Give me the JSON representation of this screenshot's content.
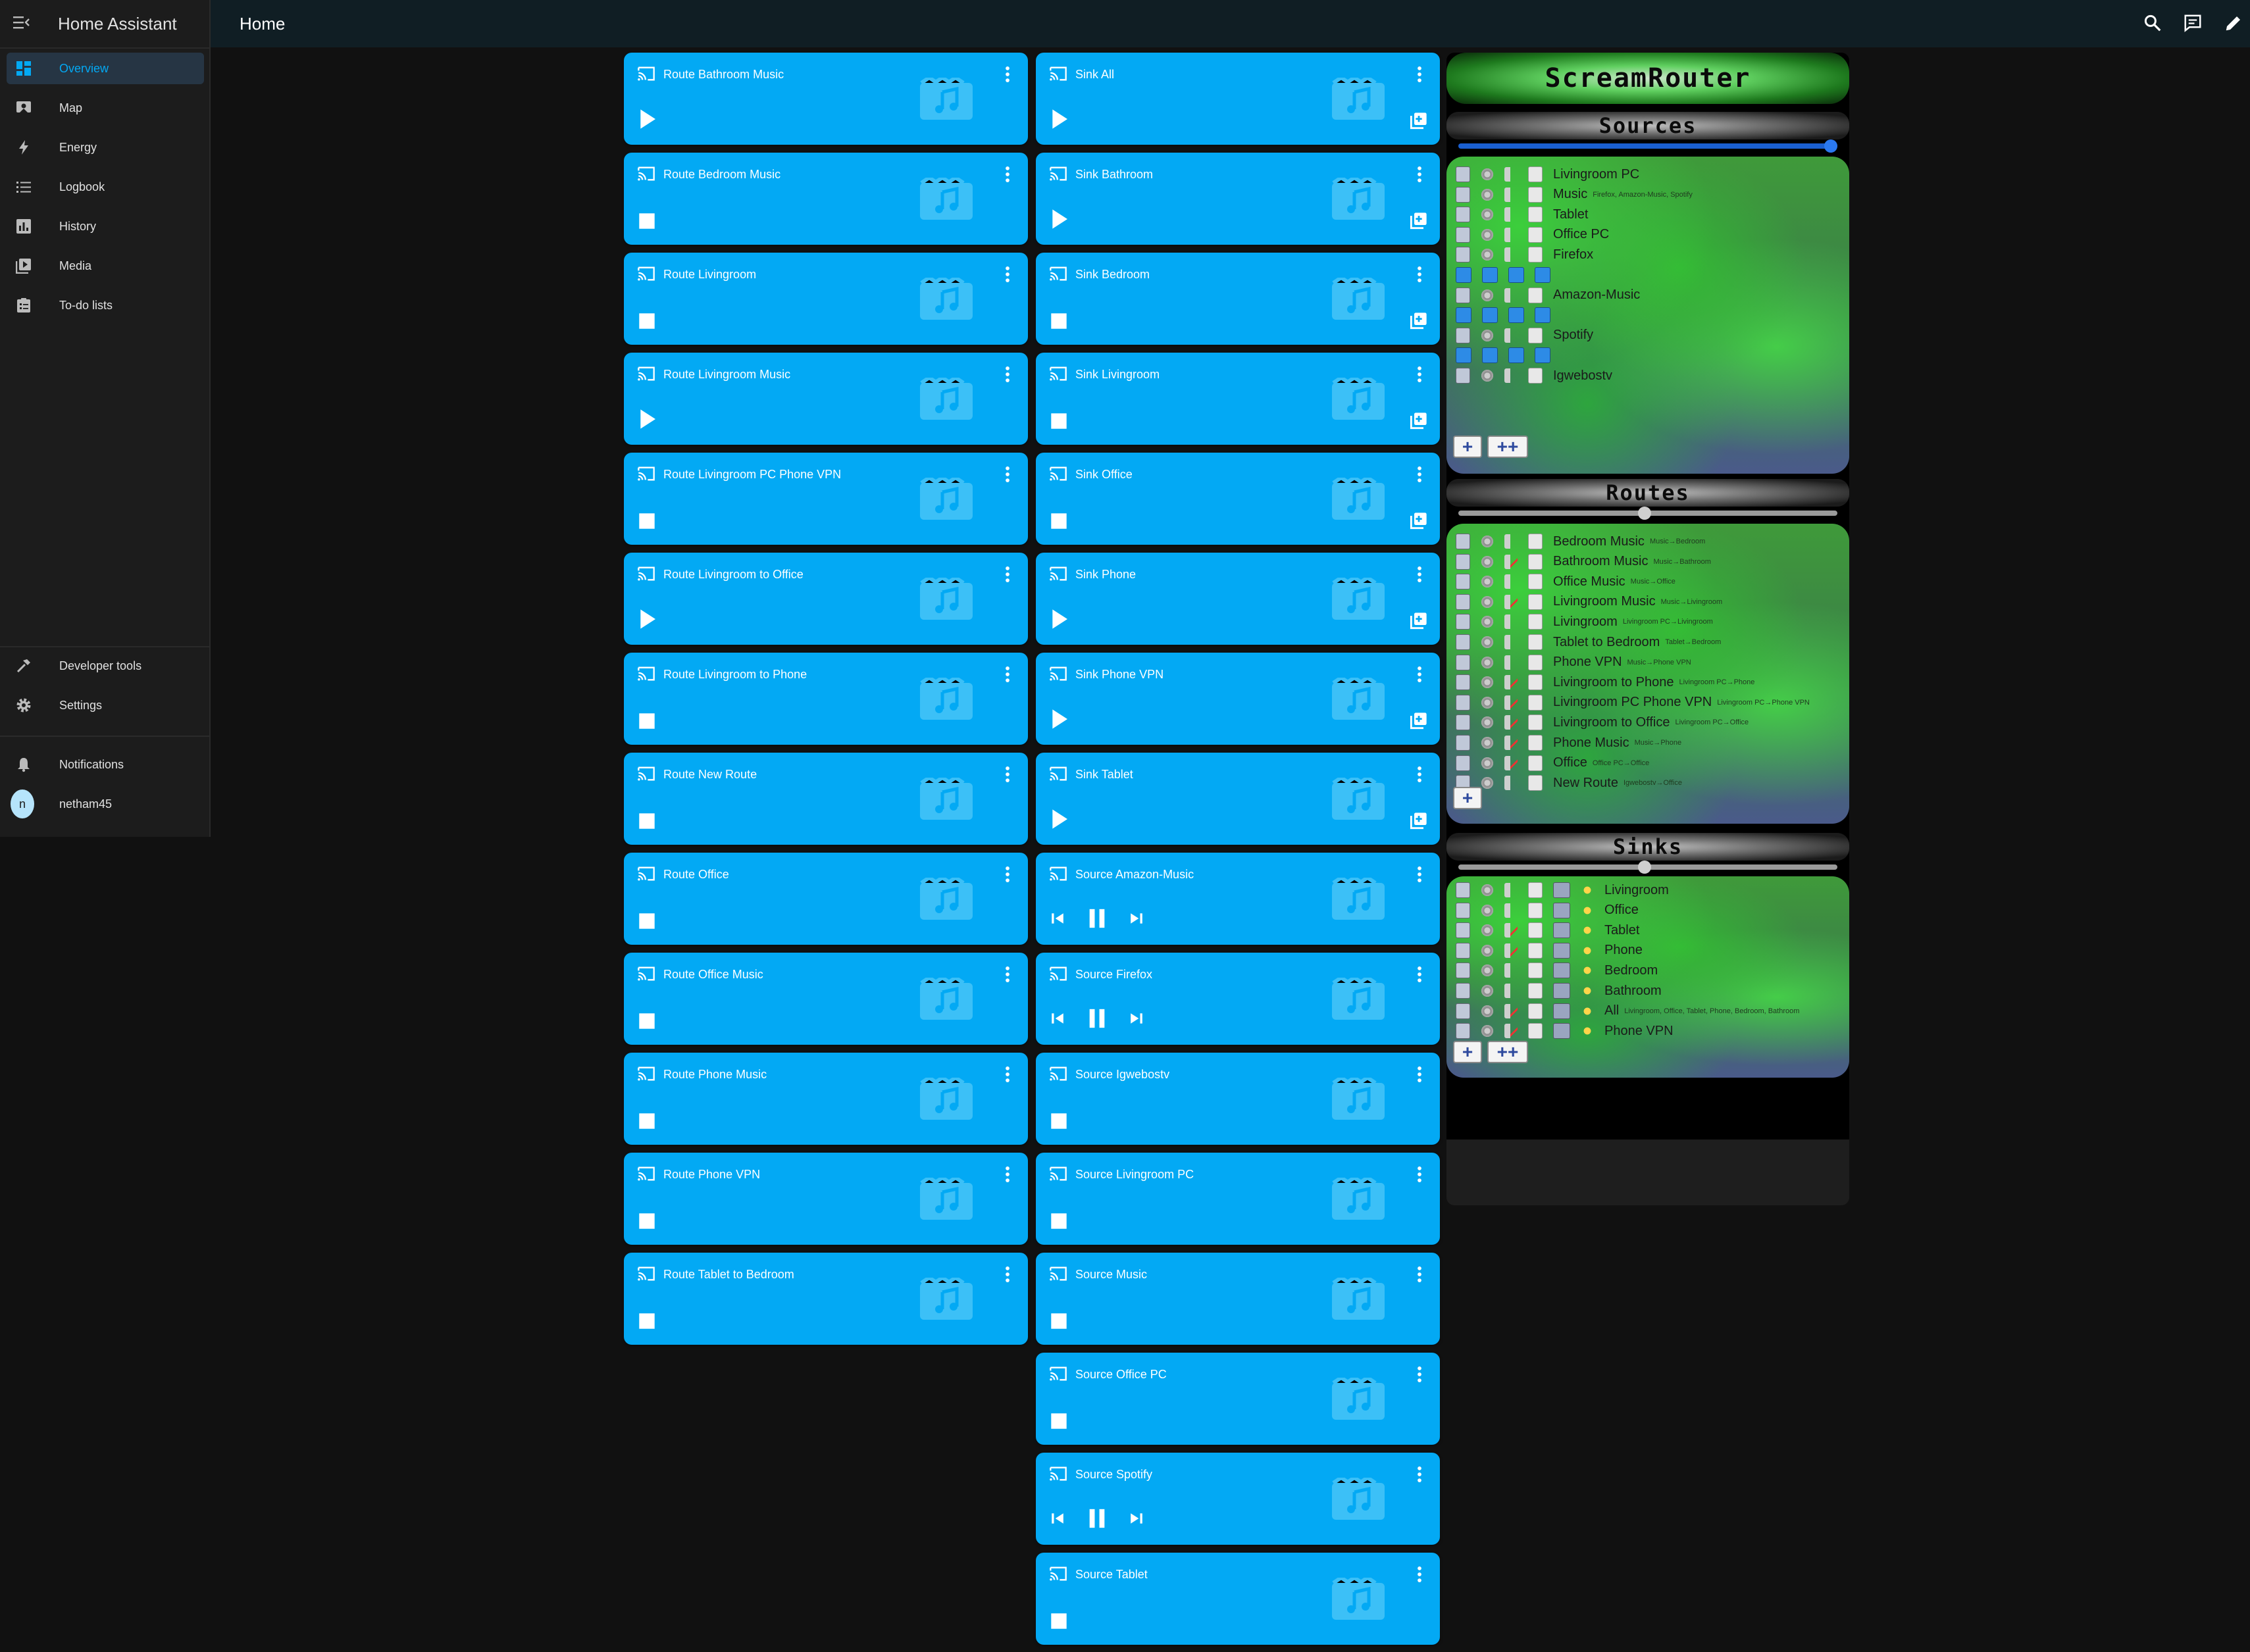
{
  "sidebar": {
    "title": "Home Assistant",
    "items": [
      {
        "label": "Overview",
        "icon": "view-dashboard-icon",
        "selected": true
      },
      {
        "label": "Map",
        "icon": "map-icon"
      },
      {
        "label": "Energy",
        "icon": "lightning-bolt-icon"
      },
      {
        "label": "Logbook",
        "icon": "format-list-bulleted-icon"
      },
      {
        "label": "History",
        "icon": "chart-box-icon"
      },
      {
        "label": "Media",
        "icon": "play-box-multiple-icon"
      },
      {
        "label": "To-do lists",
        "icon": "clipboard-list-icon"
      }
    ],
    "bottom": {
      "developer_tools": "Developer tools",
      "settings": "Settings",
      "notifications": "Notifications",
      "user": "netham45",
      "user_initial": "n"
    }
  },
  "header": {
    "title": "Home"
  },
  "cards_left": [
    {
      "name": "Route Bathroom Music",
      "control": "play"
    },
    {
      "name": "Route Bedroom Music",
      "control": "stop"
    },
    {
      "name": "Route Livingroom",
      "control": "stop"
    },
    {
      "name": "Route Livingroom Music",
      "control": "play"
    },
    {
      "name": "Route Livingroom PC Phone VPN",
      "control": "stop"
    },
    {
      "name": "Route Livingroom to Office",
      "control": "play"
    },
    {
      "name": "Route Livingroom to Phone",
      "control": "stop"
    },
    {
      "name": "Route New Route",
      "control": "stop"
    },
    {
      "name": "Route Office",
      "control": "stop"
    },
    {
      "name": "Route Office Music",
      "control": "stop"
    },
    {
      "name": "Route Phone Music",
      "control": "stop"
    },
    {
      "name": "Route Phone VPN",
      "control": "stop"
    },
    {
      "name": "Route Tablet to Bedroom",
      "control": "stop"
    }
  ],
  "cards_right": [
    {
      "name": "Sink All",
      "control": "play",
      "queue": true
    },
    {
      "name": "Sink Bathroom",
      "control": "play",
      "queue": true
    },
    {
      "name": "Sink Bedroom",
      "control": "stop",
      "queue": true
    },
    {
      "name": "Sink Livingroom",
      "control": "stop",
      "queue": true
    },
    {
      "name": "Sink Office",
      "control": "stop",
      "queue": true
    },
    {
      "name": "Sink Phone",
      "control": "play",
      "queue": true
    },
    {
      "name": "Sink Phone VPN",
      "control": "play",
      "queue": true
    },
    {
      "name": "Sink Tablet",
      "control": "play",
      "queue": true
    },
    {
      "name": "Source Amazon-Music",
      "control": "transport"
    },
    {
      "name": "Source Firefox",
      "control": "transport"
    },
    {
      "name": "Source Igwebostv",
      "control": "stop"
    },
    {
      "name": "Source Livingroom PC",
      "control": "stop"
    },
    {
      "name": "Source Music",
      "control": "stop"
    },
    {
      "name": "Source Office PC",
      "control": "stop"
    },
    {
      "name": "Source Spotify",
      "control": "transport"
    },
    {
      "name": "Source Tablet",
      "control": "stop"
    }
  ],
  "screamrouter": {
    "title": "ScreamRouter",
    "sources_title": "Sources",
    "sources_volume": 1.0,
    "sources": [
      {
        "name": "Livingroom PC",
        "sub": ""
      },
      {
        "name": "Music",
        "sub": "Firefox, Amazon-Music, Spotify"
      },
      {
        "name": "Tablet",
        "sub": ""
      },
      {
        "name": "Office PC",
        "sub": ""
      },
      {
        "name": "Firefox",
        "sub": ""
      },
      {
        "name": "",
        "sub": "",
        "controls": true
      },
      {
        "name": "Amazon-Music",
        "sub": ""
      },
      {
        "name": "",
        "sub": "",
        "controls": true
      },
      {
        "name": "Spotify",
        "sub": ""
      },
      {
        "name": "",
        "sub": "",
        "controls": true
      },
      {
        "name": "Igwebostv",
        "sub": ""
      }
    ],
    "routes_title": "Routes",
    "routes_volume": 0.5,
    "routes": [
      {
        "name": "Bedroom Music",
        "sub": "Music→Bedroom",
        "muted": false
      },
      {
        "name": "Bathroom Music",
        "sub": "Music→Bathroom",
        "muted": true
      },
      {
        "name": "Office Music",
        "sub": "Music→Office",
        "muted": false
      },
      {
        "name": "Livingroom Music",
        "sub": "Music→Livingroom",
        "muted": true
      },
      {
        "name": "Livingroom",
        "sub": "Livingroom PC→Livingroom",
        "muted": false
      },
      {
        "name": "Tablet to Bedroom",
        "sub": "Tablet→Bedroom",
        "muted": false
      },
      {
        "name": "Phone VPN",
        "sub": "Music→Phone VPN",
        "muted": false
      },
      {
        "name": "Livingroom to Phone",
        "sub": "Livingroom PC→Phone",
        "muted": true
      },
      {
        "name": "Livingroom PC Phone VPN",
        "sub": "Livingroom PC→Phone VPN",
        "muted": true
      },
      {
        "name": "Livingroom to Office",
        "sub": "Livingroom PC→Office",
        "muted": true
      },
      {
        "name": "Phone Music",
        "sub": "Music→Phone",
        "muted": true
      },
      {
        "name": "Office",
        "sub": "Office PC→Office",
        "muted": true
      },
      {
        "name": "New Route",
        "sub": "Igwebostv→Office",
        "muted": false
      }
    ],
    "sinks_title": "Sinks",
    "sinks_volume": 0.5,
    "sinks": [
      {
        "name": "Livingroom",
        "sub": "",
        "muted": false
      },
      {
        "name": "Office",
        "sub": "",
        "muted": false
      },
      {
        "name": "Tablet",
        "sub": "",
        "muted": true
      },
      {
        "name": "Phone",
        "sub": "",
        "muted": true
      },
      {
        "name": "Bedroom",
        "sub": "",
        "muted": false
      },
      {
        "name": "Bathroom",
        "sub": "",
        "muted": false
      },
      {
        "name": "All",
        "sub": "Livingroom, Office, Tablet, Phone, Bedroom, Bathroom",
        "muted": true
      },
      {
        "name": "Phone VPN",
        "sub": "",
        "muted": true
      }
    ],
    "add_label": "+",
    "add_group_label": "++"
  }
}
